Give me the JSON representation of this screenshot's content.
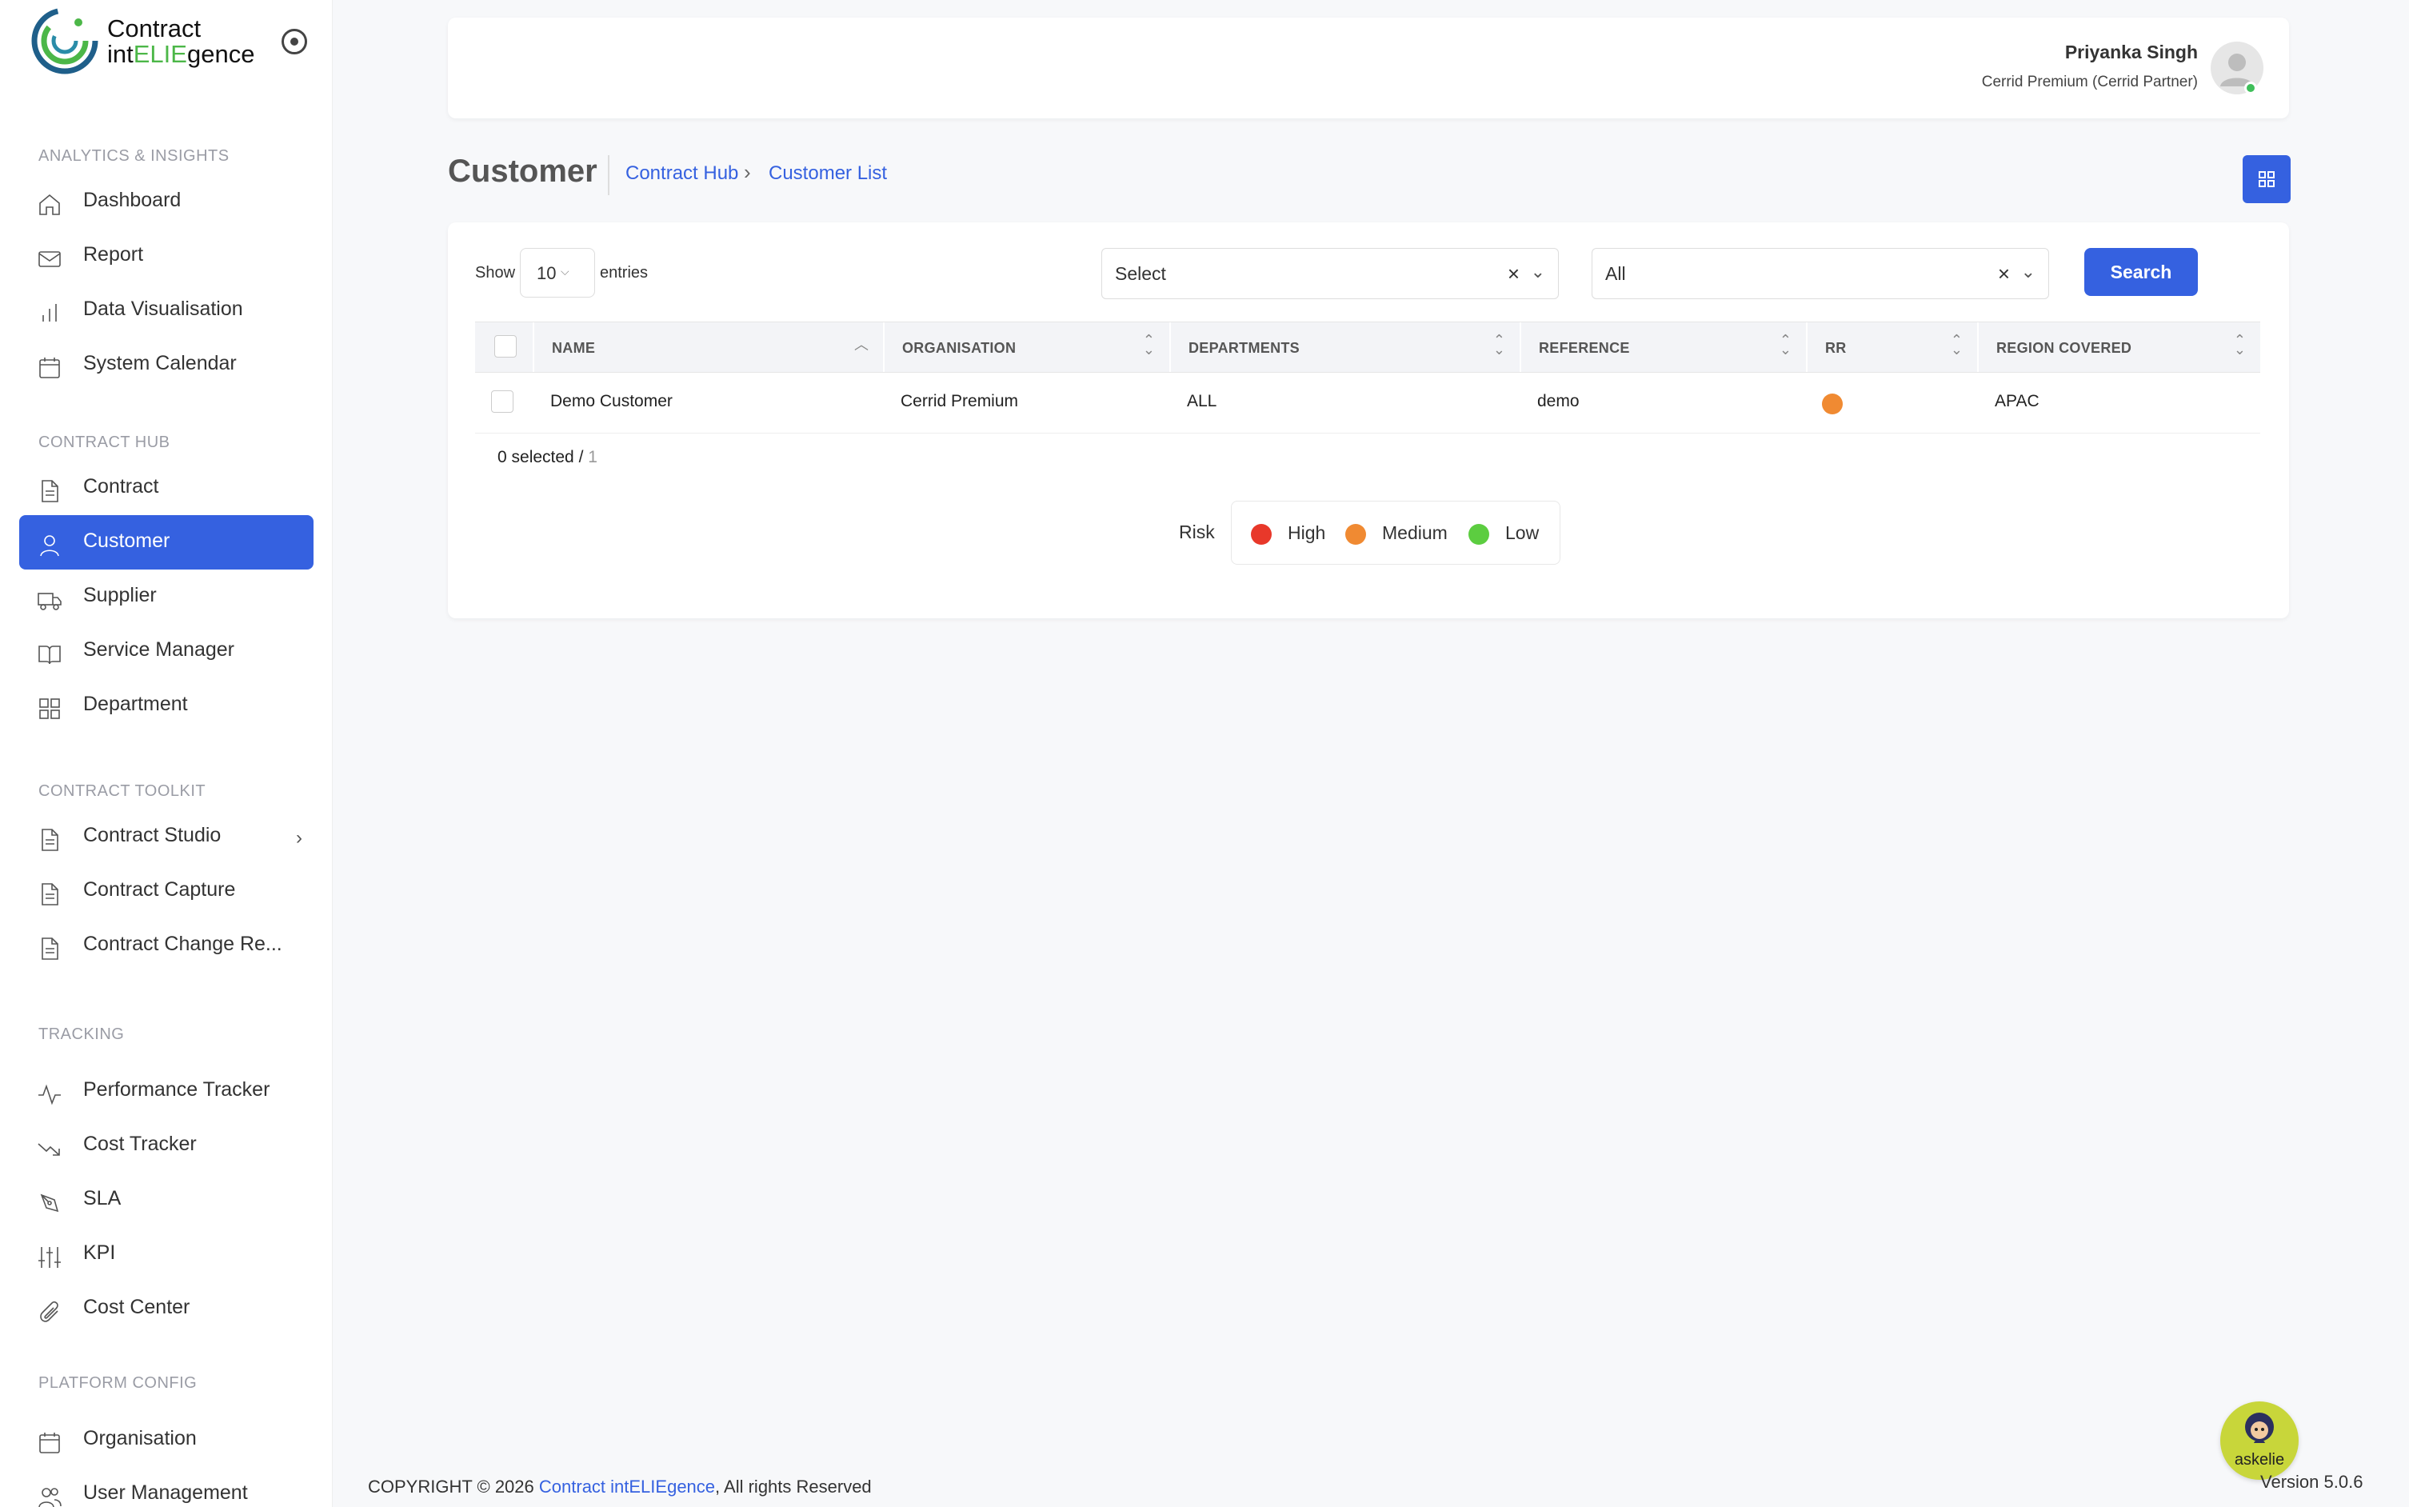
{
  "brand": {
    "line1": "Contract",
    "line2_pre": "int",
    "line2_hl": "ELIE",
    "line2_post": "gence"
  },
  "sidebar": {
    "sections": [
      {
        "title": "ANALYTICS & INSIGHTS",
        "items": [
          {
            "label": "Dashboard",
            "icon": "home-icon"
          },
          {
            "label": "Report",
            "icon": "mail-icon"
          },
          {
            "label": "Data Visualisation",
            "icon": "bar-chart-icon"
          },
          {
            "label": "System Calendar",
            "icon": "calendar-icon"
          }
        ]
      },
      {
        "title": "CONTRACT HUB",
        "items": [
          {
            "label": "Contract",
            "icon": "document-icon"
          },
          {
            "label": "Customer",
            "icon": "user-icon",
            "active": true
          },
          {
            "label": "Supplier",
            "icon": "truck-icon"
          },
          {
            "label": "Service Manager",
            "icon": "book-icon"
          },
          {
            "label": "Department",
            "icon": "grid-icon"
          }
        ]
      },
      {
        "title": "CONTRACT TOOLKIT",
        "items": [
          {
            "label": "Contract Studio",
            "icon": "document-icon",
            "has_submenu": true
          },
          {
            "label": "Contract Capture",
            "icon": "document-icon"
          },
          {
            "label": "Contract Change Re...",
            "icon": "document-icon"
          }
        ]
      },
      {
        "title": "TRACKING",
        "items": [
          {
            "label": "Performance Tracker",
            "icon": "activity-icon"
          },
          {
            "label": "Cost Tracker",
            "icon": "trending-down-icon"
          },
          {
            "label": "SLA",
            "icon": "pen-tool-icon"
          },
          {
            "label": "KPI",
            "icon": "sliders-icon"
          },
          {
            "label": "Cost Center",
            "icon": "paperclip-icon"
          }
        ]
      },
      {
        "title": "PLATFORM CONFIG",
        "items": [
          {
            "label": "Organisation",
            "icon": "calendar-icon"
          },
          {
            "label": "User Management",
            "icon": "users-icon"
          }
        ]
      }
    ]
  },
  "header": {
    "user_name": "Priyanka Singh",
    "user_role": "Cerrid Premium (Cerrid Partner)"
  },
  "page": {
    "title": "Customer",
    "breadcrumb": [
      "Contract Hub",
      "Customer List"
    ]
  },
  "controls": {
    "show_label": "Show",
    "entries_value": "10",
    "entries_label": "entries",
    "filter1_value": "Select",
    "filter2_value": "All",
    "search_label": "Search"
  },
  "table": {
    "columns": [
      "NAME",
      "ORGANISATION",
      "DEPARTMENTS",
      "REFERENCE",
      "RR",
      "REGION COVERED"
    ],
    "rows": [
      {
        "name": "Demo Customer",
        "organisation": "Cerrid Premium",
        "departments": "ALL",
        "reference": "demo",
        "rr": "Medium",
        "region": "APAC"
      }
    ],
    "selected_text": "0 selected / ",
    "total": "1"
  },
  "risk_legend": {
    "label": "Risk",
    "levels": [
      {
        "name": "High",
        "color": "#e8382a"
      },
      {
        "name": "Medium",
        "color": "#f08a32"
      },
      {
        "name": "Low",
        "color": "#5ccd40"
      }
    ]
  },
  "footer": {
    "prefix": "COPYRIGHT © 2026 ",
    "link": "Contract intELIEgence",
    "suffix": ", All rights Reserved",
    "version": "Version 5.0.6"
  },
  "assistant": {
    "label": "askelie"
  },
  "colors": {
    "accent": "#3561e0",
    "rr_medium": "#f08a32"
  }
}
